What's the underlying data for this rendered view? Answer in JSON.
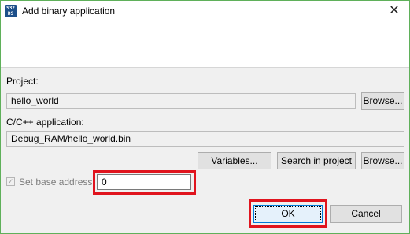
{
  "window": {
    "title": "Add binary application",
    "icon_text": "S32 DS",
    "close_glyph": "✕"
  },
  "project": {
    "label": "Project:",
    "value": "hello_world",
    "browse_label": "Browse..."
  },
  "application": {
    "label": "C/C++ application:",
    "value": "Debug_RAM/hello_world.bin",
    "variables_label": "Variables...",
    "search_label": "Search in project",
    "browse_label": "Browse..."
  },
  "base_address": {
    "checkbox_label": "Set base address:",
    "checked": true,
    "enabled": false,
    "value": "0"
  },
  "footer": {
    "ok_label": "OK",
    "cancel_label": "Cancel"
  },
  "colors": {
    "highlight": "#e0141e",
    "window_border": "#5fb05a",
    "default_button_border": "#0078d7"
  }
}
